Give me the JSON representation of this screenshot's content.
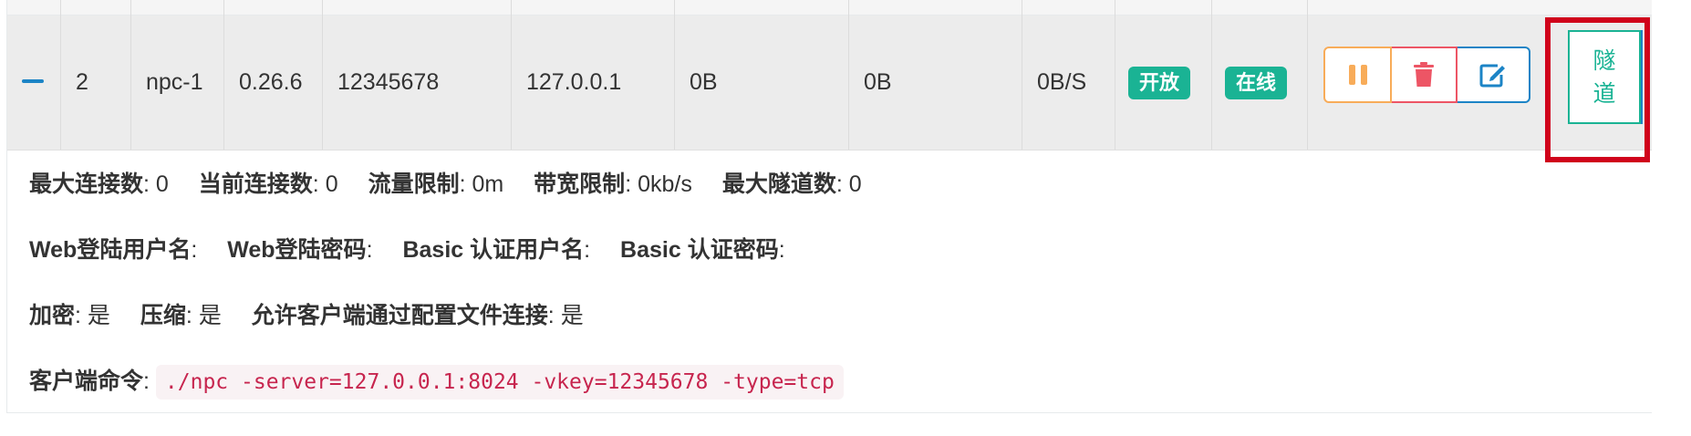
{
  "row": {
    "id": "2",
    "remark": "npc-1",
    "version": "0.26.6",
    "vkey": "12345678",
    "address": "127.0.0.1",
    "flow_in": "0B",
    "flow_out": "0B",
    "speed": "0B/S",
    "status": "开放",
    "connect": "在线"
  },
  "actions": {
    "pause": "pause-icon",
    "delete": "trash-icon",
    "edit": "edit-icon",
    "tunnel_label": "隧道"
  },
  "details": {
    "line1": [
      {
        "label": "最大连接数",
        "value": "0"
      },
      {
        "label": "当前连接数",
        "value": "0"
      },
      {
        "label": "流量限制",
        "value": "0m"
      },
      {
        "label": "带宽限制",
        "value": "0kb/s"
      },
      {
        "label": "最大隧道数",
        "value": "0"
      }
    ],
    "line2": [
      {
        "label": "Web登陆用户名",
        "value": ""
      },
      {
        "label": "Web登陆密码",
        "value": ""
      },
      {
        "label": "Basic 认证用户名",
        "value": ""
      },
      {
        "label": "Basic 认证密码",
        "value": ""
      }
    ],
    "line3": [
      {
        "label": "加密",
        "value": "是"
      },
      {
        "label": "压缩",
        "value": "是"
      },
      {
        "label": "允许客户端通过配置文件连接",
        "value": "是"
      }
    ],
    "command_label": "客户端命令",
    "command": "./npc -server=127.0.0.1:8024 -vkey=12345678 -type=tcp"
  },
  "colors": {
    "primary": "#1c84c6",
    "success": "#1ab394",
    "warning": "#f8ac59",
    "danger": "#ed5565",
    "highlight": "#d0021b"
  }
}
